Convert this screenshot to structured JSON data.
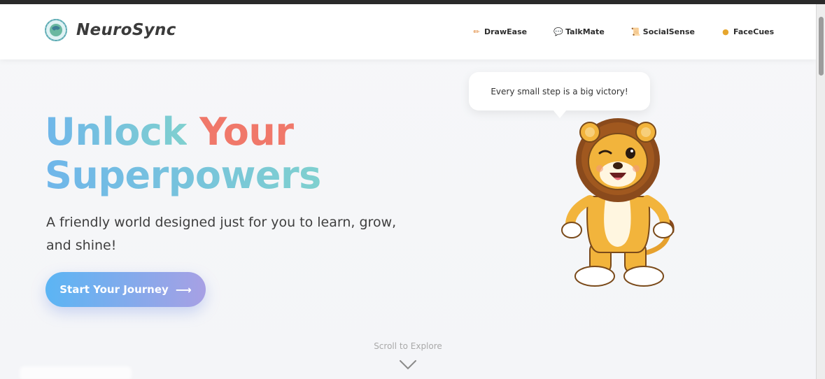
{
  "brand": {
    "name": "NeuroSync"
  },
  "nav": {
    "items": [
      {
        "label": "DrawEase",
        "icon": "pencil-icon"
      },
      {
        "label": "TalkMate",
        "icon": "speech-bubble-icon"
      },
      {
        "label": "SocialSense",
        "icon": "scroll-icon"
      },
      {
        "label": "FaceCues",
        "icon": "face-icon"
      }
    ]
  },
  "hero": {
    "headline_word1": "Unlock",
    "headline_word2": "Your",
    "headline_word3": "Superpowers",
    "subtitle": "A friendly world designed just for you to learn, grow, and shine!",
    "cta_label": "Start Your Journey",
    "cta_arrow": "⟶"
  },
  "mascot": {
    "speech": "Every small step is a big victory!"
  },
  "scroll_hint": "Scroll to Explore",
  "colors": {
    "accent_blue": "#6fb6ea",
    "accent_red": "#f0786a",
    "cta_start": "#5bb5f4",
    "cta_end": "#a7a0e4"
  }
}
